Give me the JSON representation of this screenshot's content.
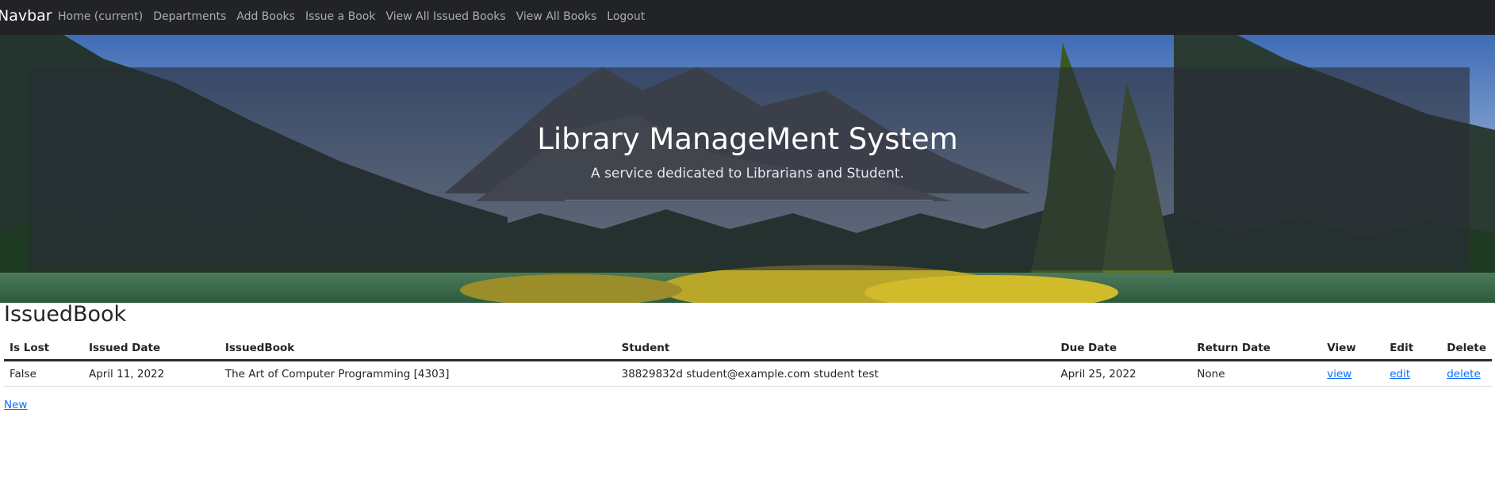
{
  "navbar": {
    "brand": "Navbar",
    "links": [
      "Home (current)",
      "Departments",
      "Add Books",
      "Issue a Book",
      "View All Issued Books",
      "View All Books",
      "Logout"
    ]
  },
  "hero": {
    "title": "Library ManageMent System",
    "subtitle": "A service dedicated to Librarians and Student."
  },
  "page": {
    "heading": "IssuedBook",
    "new_link": "New"
  },
  "table": {
    "headers": [
      "Is Lost",
      "Issued Date",
      "IssuedBook",
      "Student",
      "Due Date",
      "Return Date",
      "View",
      "Edit",
      "Delete"
    ],
    "rows": [
      {
        "is_lost": "False",
        "issued_date": "April 11, 2022",
        "book": "The Art of Computer Programming [4303]",
        "student": "38829832d student@example.com student test",
        "due_date": "April 25, 2022",
        "return_date": "None",
        "view": "view",
        "edit": "edit",
        "delete": "delete"
      }
    ]
  },
  "colors": {
    "navbar_bg": "#212326",
    "link": "#0d6efd"
  }
}
